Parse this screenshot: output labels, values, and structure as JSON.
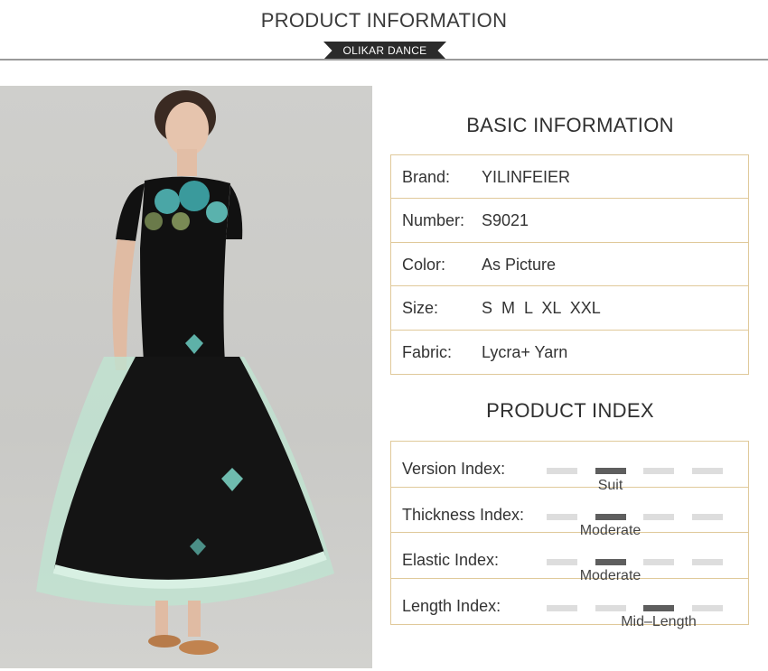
{
  "header": {
    "title": "PRODUCT INFORMATION",
    "ribbon": "OLIKAR DANCE"
  },
  "basic": {
    "title": "BASIC INFORMATION",
    "rows": [
      {
        "label": "Brand:",
        "value": "YILINFEIER"
      },
      {
        "label": "Number:",
        "value": "S9021"
      },
      {
        "label": "Color:",
        "value": "As Picture"
      },
      {
        "label": "Size:",
        "value": "S  M  L  XL  XXL"
      },
      {
        "label": "Fabric:",
        "value": "Lycra+ Yarn"
      }
    ]
  },
  "product_index": {
    "title": "PRODUCT INDEX",
    "levels": 4,
    "rows": [
      {
        "label": "Version Index:",
        "level": 2,
        "caption": "Suit"
      },
      {
        "label": "Thickness Index:",
        "level": 2,
        "caption": "Moderate"
      },
      {
        "label": "Elastic Index:",
        "level": 2,
        "caption": "Moderate"
      },
      {
        "label": "Length Index:",
        "level": 3,
        "caption": "Mid–Length"
      }
    ]
  },
  "colors": {
    "accent_border": "#e0c99a",
    "active_segment": "#5e5e5e",
    "inactive_segment": "#dddddd"
  }
}
